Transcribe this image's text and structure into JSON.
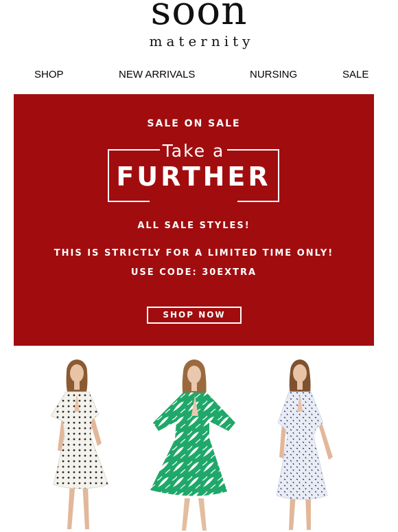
{
  "brand": {
    "name": "soon",
    "tagline": "maternity"
  },
  "nav": {
    "items": [
      {
        "label": "SHOP"
      },
      {
        "label": "NEW ARRIVALS"
      },
      {
        "label": "NURSING"
      },
      {
        "label": "SALE"
      }
    ]
  },
  "banner": {
    "background": "#a10d0f",
    "kicker": "SALE ON SALE",
    "headline_small": "Take a",
    "headline_large": "FURTHER",
    "line1": "ALL SALE STYLES!",
    "line2": "THIS IS STRICTLY FOR A LIMITED TIME ONLY!",
    "code": "USE CODE: 30EXTRA",
    "cta": "SHOP NOW"
  },
  "products": [
    {
      "name": "polka-dot-dress",
      "pattern_color": "#2a2a2a",
      "base_color": "#f4f2ec"
    },
    {
      "name": "green-leaf-print-dress",
      "pattern_color": "#ffffff",
      "base_color": "#1fa86a"
    },
    {
      "name": "blue-spot-print-dress",
      "pattern_color": "#2d3a70",
      "base_color": "#e9ecf4"
    }
  ]
}
